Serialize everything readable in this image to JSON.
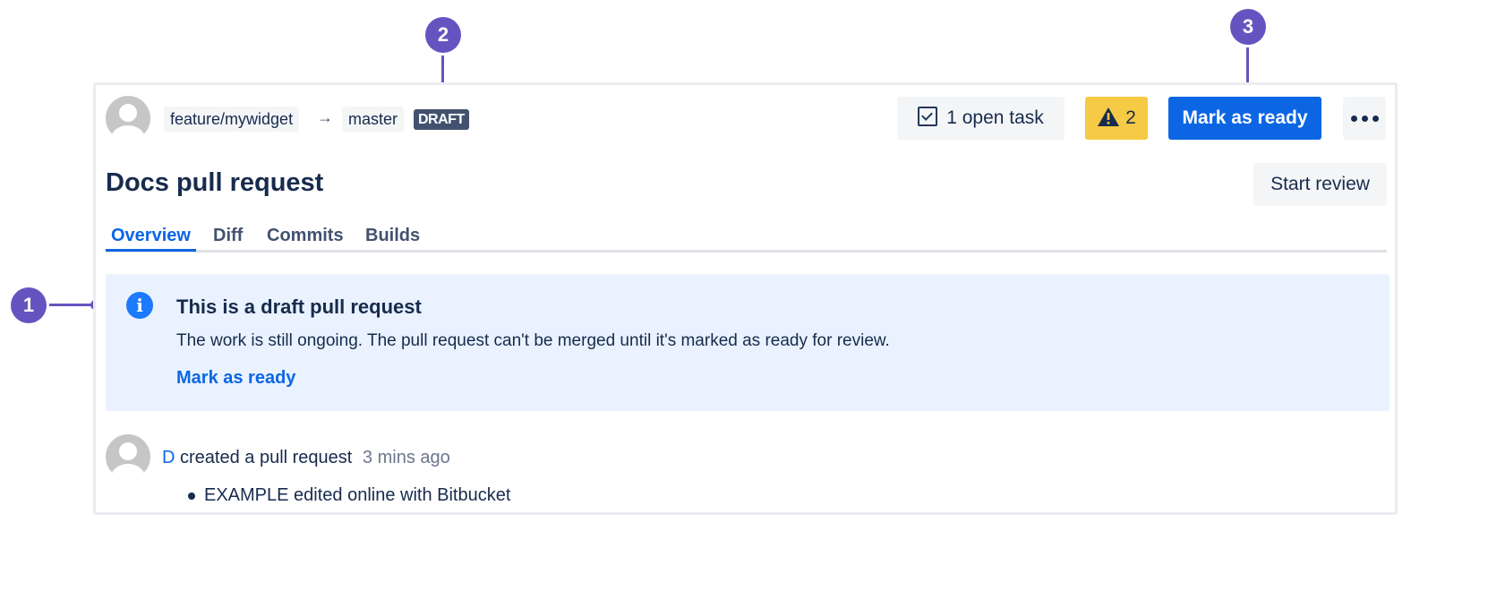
{
  "header": {
    "source_branch": "feature/mywidget",
    "arrow": "→",
    "target_branch": "master",
    "status_badge": "DRAFT",
    "open_tasks_label": "1 open task",
    "warnings_count": "2",
    "mark_ready_label": "Mark as ready",
    "more_actions_icon": "ellipsis-icon"
  },
  "pull_request": {
    "title": "Docs pull request",
    "start_review_label": "Start review"
  },
  "tabs": [
    {
      "label": "Overview",
      "active": true
    },
    {
      "label": "Diff",
      "active": false
    },
    {
      "label": "Commits",
      "active": false
    },
    {
      "label": "Builds",
      "active": false
    }
  ],
  "info_banner": {
    "icon": "info-icon",
    "title": "This is a draft pull request",
    "body": "The work is still ongoing. The pull request can't be merged until it's marked as ready for review.",
    "action_label": "Mark as ready"
  },
  "activity": {
    "user_initial": "D",
    "action": "created a pull request",
    "time": "3 mins ago",
    "items": [
      "EXAMPLE edited online with Bitbucket"
    ]
  },
  "callouts": [
    "1",
    "2",
    "3"
  ],
  "colors": {
    "primary": "#0c66e4",
    "callout": "#6554c0",
    "info_bg": "#e9f2fe",
    "warning": "#f6ca45",
    "draft_badge": "#42526e"
  }
}
